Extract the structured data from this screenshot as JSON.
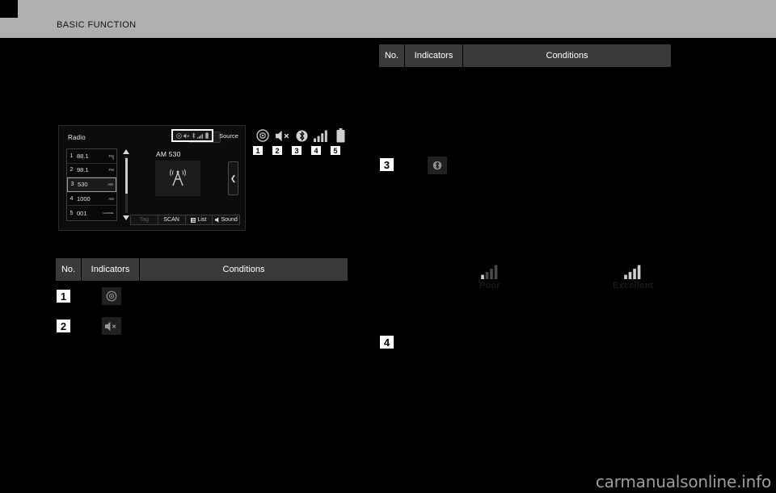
{
  "header": {
    "title": "BASIC FUNCTION",
    "band_color": "#b0b0b0"
  },
  "radio_screen": {
    "title": "Radio",
    "link_icon": "link-chain-icon",
    "source_label": "Source",
    "station_label": "AM 530",
    "artwork_icon": "radio-tower-icon",
    "next_chevron": "chevron-left-icon",
    "status_bar_icons": [
      "disc-icon",
      "mute-icon",
      "bluetooth-icon",
      "signal-icon",
      "battery-icon"
    ],
    "presets": [
      {
        "no": "1",
        "freq": "88.1",
        "band": "FM",
        "hd": true,
        "selected": false
      },
      {
        "no": "2",
        "freq": "98.1",
        "band": "FM",
        "hd": false,
        "selected": false
      },
      {
        "no": "3",
        "freq": "530",
        "band": "AM",
        "hd": false,
        "selected": true
      },
      {
        "no": "4",
        "freq": "1000",
        "band": "AM",
        "hd": false,
        "selected": false
      },
      {
        "no": "5",
        "freq": "001",
        "band": "CHANNEL",
        "hd": false,
        "selected": false
      }
    ],
    "scroll_up_icon": "triangle-up-icon",
    "scroll_down_icon": "triangle-down-icon",
    "buttons": [
      {
        "label": "Tag",
        "dim": true,
        "icon": ""
      },
      {
        "label": "SCAN",
        "dim": false,
        "icon": ""
      },
      {
        "label": "List",
        "dim": false,
        "icon": "list-icon"
      },
      {
        "label": "Sound",
        "dim": false,
        "icon": "speaker-icon"
      }
    ]
  },
  "indicator_callouts": [
    {
      "number": "1",
      "icon": "disc-icon"
    },
    {
      "number": "2",
      "icon": "mute-icon"
    },
    {
      "number": "3",
      "icon": "bluetooth-icon"
    },
    {
      "number": "4",
      "icon": "signal-bars-icon"
    },
    {
      "number": "5",
      "icon": "battery-icon"
    }
  ],
  "table_left": {
    "headers": {
      "no": "No.",
      "indicators": "Indicators",
      "conditions": "Conditions"
    },
    "rows": [
      {
        "no": "1",
        "icon": "disc-icon",
        "conditions": ""
      },
      {
        "no": "2",
        "icon": "mute-icon",
        "conditions": ""
      }
    ]
  },
  "table_right": {
    "headers": {
      "no": "No.",
      "indicators": "Indicators",
      "conditions": "Conditions"
    },
    "rows": [
      {
        "no": "3",
        "icon": "bluetooth-icon",
        "conditions": ""
      },
      {
        "no": "4",
        "icon": "signal-bars-icon",
        "conditions": ""
      }
    ]
  },
  "signal_examples": [
    {
      "caption": "Poor",
      "bars_lit": 1,
      "icon": "signal-bars-icon"
    },
    {
      "caption": "Excellent",
      "bars_lit": 4,
      "icon": "signal-bars-icon"
    }
  ],
  "watermark": {
    "text": "carmanualsonline.info"
  }
}
